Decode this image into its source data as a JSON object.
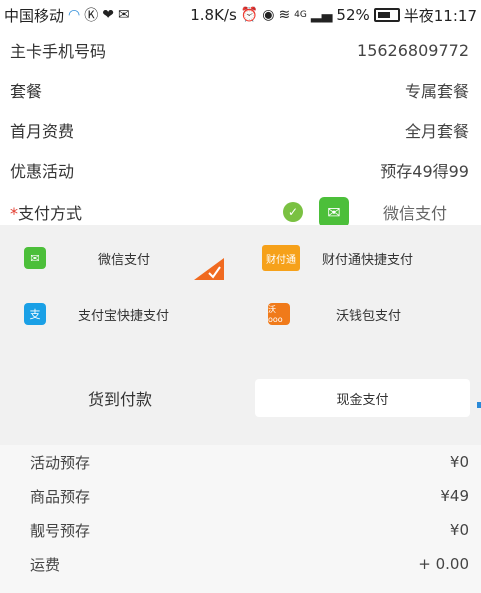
{
  "statusbar": {
    "carrier": "中国移动",
    "speed": "1.8K/s",
    "network": "4G",
    "battery": "52%",
    "time": "半夜11:17"
  },
  "info_rows": [
    {
      "label": "主卡手机号码",
      "value": "15626809772"
    },
    {
      "label": "套餐",
      "value": "专属套餐"
    },
    {
      "label": "首月资费",
      "value": "全月套餐"
    },
    {
      "label": "优惠活动",
      "value": "预存49得99"
    }
  ],
  "payment": {
    "required_mark": "*",
    "label": "支付方式",
    "selected": "微信支付"
  },
  "options": {
    "wechat": "微信支付",
    "tenpay": "财付通快捷支付",
    "tenpay_logo": "财付通",
    "alipay": "支付宝快捷支付",
    "alipay_logo": "支",
    "wo": "沃钱包支付",
    "wo_logo": "沃ooo",
    "cod": "货到付款",
    "cash": "现金支付"
  },
  "summary": [
    {
      "label": "活动预存",
      "value": "¥0"
    },
    {
      "label": "商品预存",
      "value": "¥49"
    },
    {
      "label": "靓号预存",
      "value": "¥0"
    },
    {
      "label": "运费",
      "value": "+ 0.00"
    }
  ],
  "colors": {
    "wechat_green": "#4cbf3a",
    "check_green": "#7ac142",
    "alipay_blue": "#1aa0e6",
    "wo_orange": "#f07a1a",
    "required_red": "#e23b2e",
    "corner_orange": "#f06a20"
  }
}
